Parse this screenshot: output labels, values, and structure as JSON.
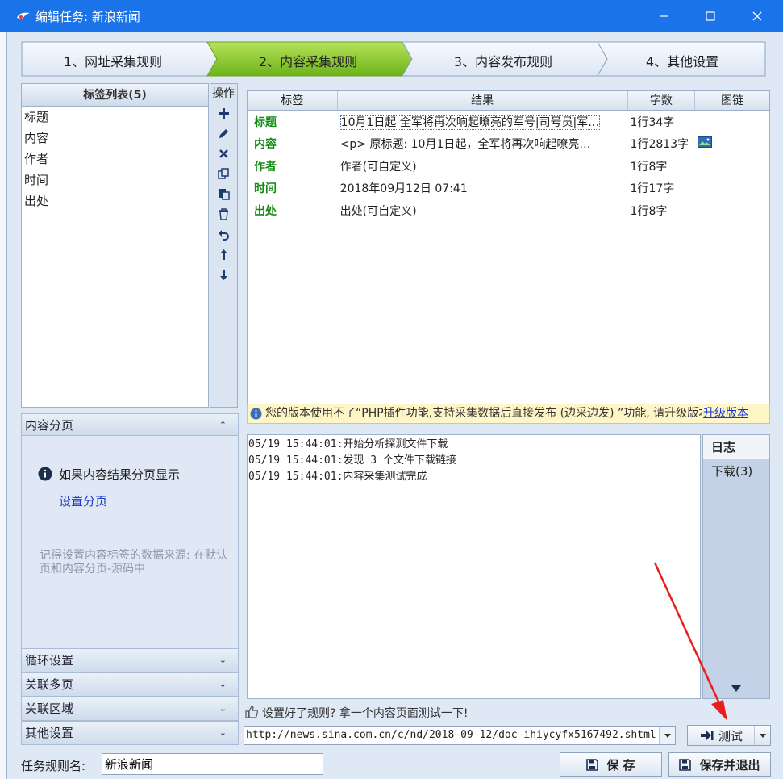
{
  "titlebar": {
    "title": "编辑任务: 新浪新闻"
  },
  "steps": [
    {
      "label": "1、网址采集规则",
      "active": false
    },
    {
      "label": "2、内容采集规则",
      "active": true
    },
    {
      "label": "3、内容发布规则",
      "active": false
    },
    {
      "label": "4、其他设置",
      "active": false
    }
  ],
  "taglist": {
    "header": "标签列表(5)",
    "items": [
      "标题",
      "内容",
      "作者",
      "时间",
      "出处"
    ]
  },
  "ops": {
    "header": "操作"
  },
  "table": {
    "columns": [
      "标签",
      "结果",
      "字数",
      "图链"
    ],
    "rows": [
      {
        "tag": "标题",
        "result": "10月1日起 全军将再次响起嘹亮的军号|司号员|军…",
        "count": "1行34字"
      },
      {
        "tag": "内容",
        "result": "<p>    原标题: 10月1日起，全军将再次响起嘹亮…",
        "count": "1行2813字"
      },
      {
        "tag": "作者",
        "result": "作者(可自定义)",
        "count": "1行8字"
      },
      {
        "tag": "时间",
        "result": "2018年09月12日 07:41",
        "count": "1行17字"
      },
      {
        "tag": "出处",
        "result": "出处(可自定义)",
        "count": "1行8字"
      }
    ]
  },
  "banner": {
    "text": "您的版本使用不了“PHP插件功能,支持采集数据后直接发布 (边采边发) ”功能, 请升级版本",
    "link": "升级版本"
  },
  "accordion": {
    "paging": {
      "title": "内容分页",
      "tip": "如果内容结果分页显示",
      "link": "设置分页",
      "note": "记得设置内容标签的数据来源: 在默认页和内容分页-源码中"
    },
    "sections": [
      "循环设置",
      "关联多页",
      "关联区域",
      "其他设置"
    ]
  },
  "log": {
    "lines": [
      "05/19 15:44:01:开始分析探测文件下载",
      "05/19 15:44:01:发现 3 个文件下载链接",
      "05/19 15:44:01:内容采集测试完成"
    ],
    "tabs": [
      "日志",
      "下载(3)"
    ]
  },
  "test": {
    "hint": "设置好了规则? 拿一个内容页面测试一下!",
    "url": "http://news.sina.com.cn/c/nd/2018-09-12/doc-ihiycyfx5167492.shtml",
    "button": "测试"
  },
  "bottom": {
    "name_label": "任务规则名:",
    "name_value": "新浪新闻",
    "save": "保 存",
    "save_exit": "保存并退出"
  },
  "colors": {
    "titlebar": "#1a73e8",
    "active_step": "#7ec21f",
    "tag_label": "#148a14",
    "link": "#1a37c9",
    "annotation_arrow": "#e8201d"
  }
}
